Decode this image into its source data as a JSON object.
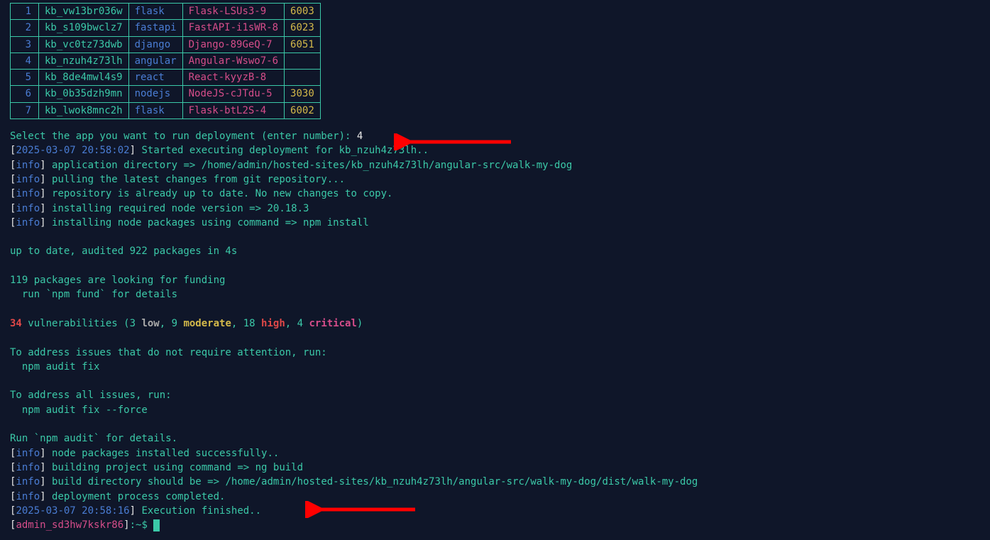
{
  "table": {
    "rows": [
      {
        "n": "1",
        "id": "kb_vw13br036w",
        "fw": "flask",
        "name": "Flask-LSUs3-9",
        "port": "6003"
      },
      {
        "n": "2",
        "id": "kb_s109bwclz7",
        "fw": "fastapi",
        "name": "FastAPI-i1sWR-8",
        "port": "6023"
      },
      {
        "n": "3",
        "id": "kb_vc0tz73dwb",
        "fw": "django",
        "name": "Django-89GeQ-7",
        "port": "6051"
      },
      {
        "n": "4",
        "id": "kb_nzuh4z73lh",
        "fw": "angular",
        "name": "Angular-Wswo7-6",
        "port": ""
      },
      {
        "n": "5",
        "id": "kb_8de4mwl4s9",
        "fw": "react",
        "name": "React-kyyzB-8",
        "port": ""
      },
      {
        "n": "6",
        "id": "kb_0b35dzh9mn",
        "fw": "nodejs",
        "name": "NodeJS-cJTdu-5",
        "port": "3030"
      },
      {
        "n": "7",
        "id": "kb_lwok8mnc2h",
        "fw": "flask",
        "name": "Flask-btL2S-4",
        "port": "6002"
      }
    ]
  },
  "prompt": {
    "select_text": "Select the app you want to run deployment (enter number): ",
    "selection_value": "4",
    "ts_start_open": "[",
    "ts_start": "2025-03-07 20:58:02",
    "ts_start_close": "]",
    "ts_start_msg": " Started executing deployment for kb_nzuh4z73lh.."
  },
  "info_lines": [
    {
      "msg": " application directory => /home/admin/hosted-sites/kb_nzuh4z73lh/angular-src/walk-my-dog"
    },
    {
      "msg": " pulling the latest changes from git repository..."
    },
    {
      "msg": " repository is already up to date. No new changes to copy."
    },
    {
      "msg": " installing required node version => 20.18.3"
    },
    {
      "msg": " installing node packages using command => npm install"
    }
  ],
  "info_tag": "info",
  "npm": {
    "uptodate": "up to date, audited 922 packages in 4s",
    "funding1": "119 packages are looking for funding",
    "funding2": "  run `npm fund` for details",
    "vuln_count": "34",
    "vuln_text_prefix": " vulnerabilities (3 ",
    "vuln_low": "low",
    "vuln_mid1": ", 9 ",
    "vuln_moderate": "moderate",
    "vuln_mid2": ", 18 ",
    "vuln_high": "high",
    "vuln_mid3": ", 4 ",
    "vuln_critical": "critical",
    "vuln_end": ")",
    "addr1": "To address issues that do not require attention, run:",
    "addr2": "  npm audit fix",
    "addr3": "To address all issues, run:",
    "addr4": "  npm audit fix --force",
    "addr5": "Run `npm audit` for details."
  },
  "info_lines2": [
    {
      "msg": " node packages installed successfully.."
    },
    {
      "msg": " building project using command => ng build"
    },
    {
      "msg": " build directory should be => /home/admin/hosted-sites/kb_nzuh4z73lh/angular-src/walk-my-dog/dist/walk-my-dog"
    },
    {
      "msg": " deployment process completed."
    }
  ],
  "finish": {
    "open": "[",
    "ts": "2025-03-07 20:58:16",
    "close": "]",
    "msg": " Execution finished.."
  },
  "shell_prompt": {
    "open": "[",
    "user": "admin_sd3hw7kskr86",
    "close": "]",
    "path": ":~$ "
  }
}
